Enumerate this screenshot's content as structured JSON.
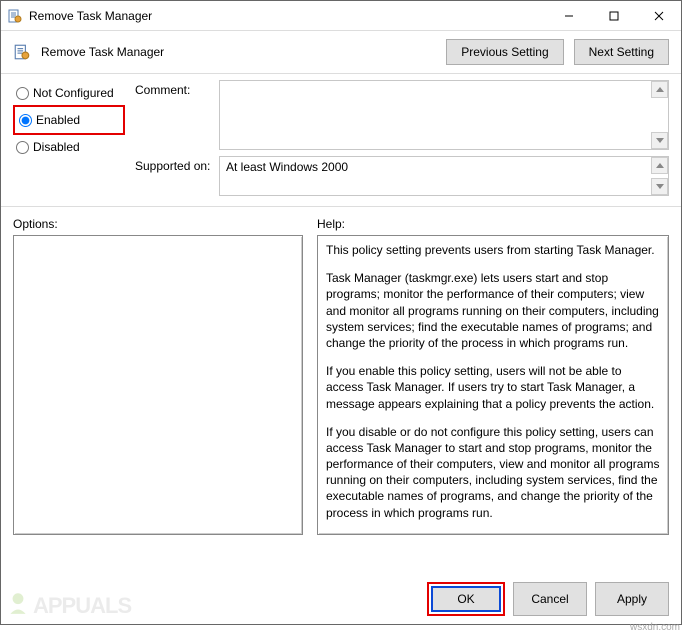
{
  "window": {
    "title": "Remove Task Manager"
  },
  "header": {
    "title": "Remove Task Manager",
    "prev_btn": "Previous Setting",
    "next_btn": "Next Setting"
  },
  "state": {
    "not_configured": "Not Configured",
    "enabled": "Enabled",
    "disabled": "Disabled",
    "selected": "enabled"
  },
  "fields": {
    "comment_label": "Comment:",
    "comment_value": "",
    "supported_label": "Supported on:",
    "supported_value": "At least Windows 2000"
  },
  "sections": {
    "options_label": "Options:",
    "help_label": "Help:"
  },
  "help": {
    "p1": "This policy setting prevents users from starting Task Manager.",
    "p2": "Task Manager (taskmgr.exe) lets users start and stop programs; monitor the performance of their computers; view and monitor all programs running on their computers, including system services; find the executable names of programs; and change the priority of the process in which programs run.",
    "p3": "If you enable this policy setting, users will not be able to access Task Manager. If users try to start Task Manager, a message appears explaining that a policy prevents the action.",
    "p4": "If you disable or do not configure this policy setting, users can access Task Manager to  start and stop programs, monitor the performance of their computers, view and monitor all programs running on their computers, including system services, find the executable names of programs, and change the priority of the process in which programs run."
  },
  "buttons": {
    "ok": "OK",
    "cancel": "Cancel",
    "apply": "Apply"
  },
  "watermark": {
    "text": "APPUALS",
    "source": "wsxdn.com"
  }
}
